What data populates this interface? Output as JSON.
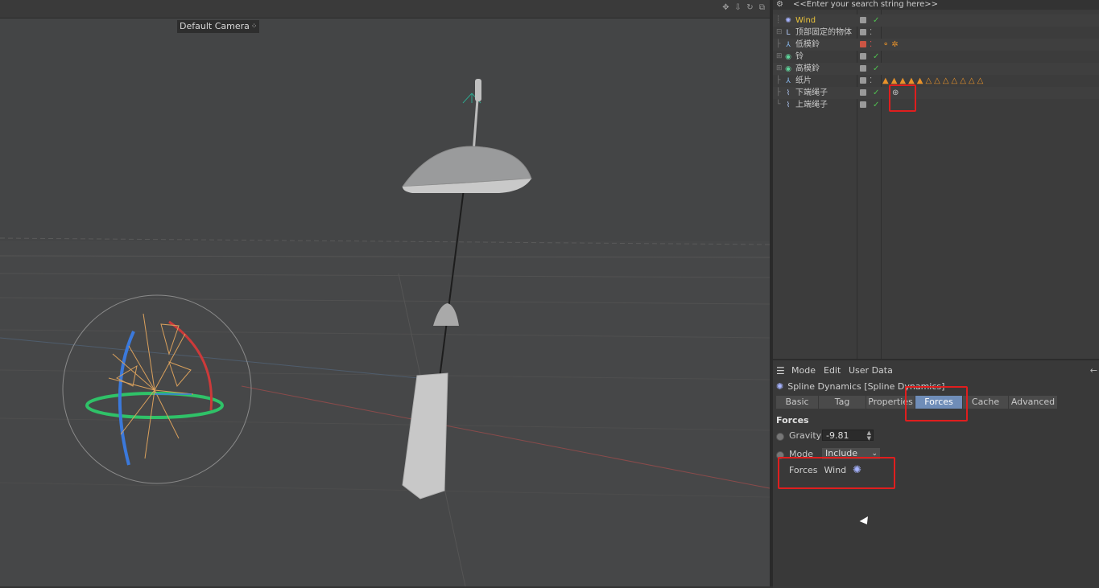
{
  "viewport": {
    "camera_label": "Default Camera",
    "camera_icon": "camera-dots-icon",
    "top_icons": [
      "move-icon",
      "down-arrow-icon",
      "rotate-icon",
      "maximize-icon"
    ]
  },
  "object_manager": {
    "search_placeholder": "<<Enter your search string here>>",
    "gear_icon": "gear-icon",
    "objects": [
      {
        "name": "Wind",
        "icon": "wind-icon",
        "highlight": true,
        "check": "✓",
        "tags": ""
      },
      {
        "name": "顶部固定的物体",
        "icon": "null-icon",
        "highlight": false,
        "check": "",
        "tags": ""
      },
      {
        "name": "低模鈴",
        "icon": "joint-icon",
        "highlight": false,
        "check": "",
        "tags": "⚬✲"
      },
      {
        "name": "铃",
        "icon": "object-icon",
        "highlight": false,
        "check": "✓",
        "tags": ""
      },
      {
        "name": "高模鈴",
        "icon": "object-icon",
        "highlight": false,
        "check": "✓",
        "tags": ""
      },
      {
        "name": "纸片",
        "icon": "joint-icon",
        "highlight": false,
        "check": "",
        "tags": "▲▲▲▲▲△△△△△△△"
      },
      {
        "name": "下端绳子",
        "icon": "spline-icon",
        "highlight": false,
        "check": "✓",
        "tags": "⊛"
      },
      {
        "name": "上端绳子",
        "icon": "spline-icon",
        "highlight": false,
        "check": "✓",
        "tags": ""
      }
    ]
  },
  "attribute_manager": {
    "menu": {
      "mode": "Mode",
      "edit": "Edit",
      "user_data": "User Data"
    },
    "title": "Spline Dynamics [Spline Dynamics]",
    "tabs": [
      "Basic",
      "Tag",
      "Properties",
      "Forces",
      "Cache",
      "Advanced"
    ],
    "active_tab": "Forces",
    "section": "Forces",
    "gravity_label": "Gravity",
    "gravity_value": "-9.81",
    "mode_label": "Mode",
    "mode_value": "Include",
    "forces_label": "Forces",
    "forces_value": "Wind"
  },
  "colors": {
    "highlight_box": "#e01e1e",
    "active_tab": "#6f8db8",
    "wind_text": "#e8c23a"
  }
}
